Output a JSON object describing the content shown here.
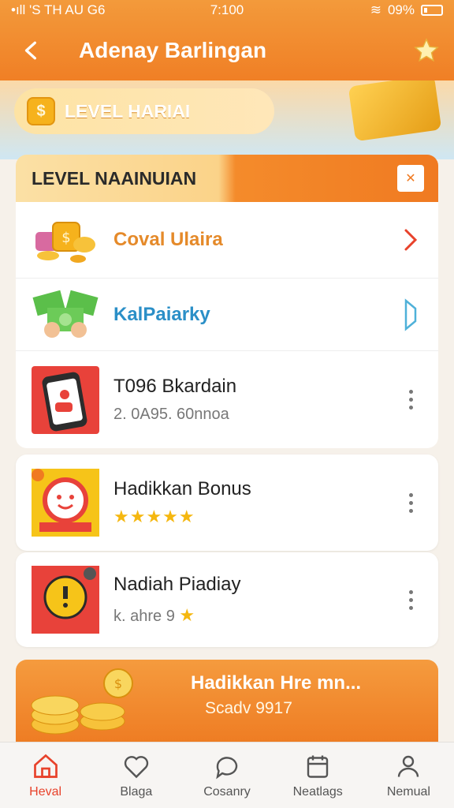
{
  "status_bar": {
    "carrier": "•ıll 'S TH AU G6",
    "time": "7:100",
    "battery": "09%"
  },
  "header": {
    "title": "Adenay Barlingan"
  },
  "banner": {
    "daily_label": "LEVEL HARIAI"
  },
  "section": {
    "title": "LEVEL NAAINUIAN",
    "rows": [
      {
        "title": "Coval Ulaira",
        "subtitle": "",
        "trailing": "chevron"
      },
      {
        "title": "KalPaiarky",
        "subtitle": "",
        "trailing": "chevron-outline"
      },
      {
        "title": "T096 Bkardain",
        "subtitle": "2. 0A95. 60nnoa",
        "trailing": "more"
      }
    ]
  },
  "cards": [
    {
      "title": "Hadikkan Bonus",
      "stars": "★★★★★",
      "trailing": "more"
    },
    {
      "title": "Nadiah Piadiay",
      "subtitle": "k. ahre 9",
      "stars": "★",
      "trailing": "more"
    }
  ],
  "bonus_banner": {
    "title": "Hadikkan Hre mn...",
    "subtitle": "Scadv 9917"
  },
  "tabs": [
    {
      "label": "Heval",
      "icon": "home-icon",
      "active": true
    },
    {
      "label": "Blaga",
      "icon": "heart-icon",
      "active": false
    },
    {
      "label": "Cosanry",
      "icon": "chat-icon",
      "active": false
    },
    {
      "label": "Neatlags",
      "icon": "calendar-icon",
      "active": false
    },
    {
      "label": "Nemual",
      "icon": "person-icon",
      "active": false
    }
  ],
  "colors": {
    "accent": "#f07a21",
    "active_tab": "#e8422b",
    "star": "#f5b70f",
    "link_blue": "#2b8fc7"
  }
}
